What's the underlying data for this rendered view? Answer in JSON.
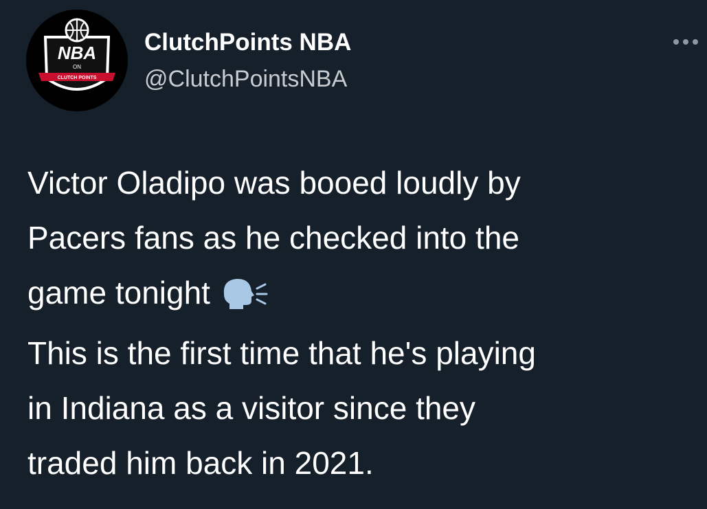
{
  "tweet": {
    "author": {
      "display_name": "ClutchPoints NBA",
      "handle": "@ClutchPointsNBA",
      "avatar": {
        "icon": "nba-on-clutchpoints-logo-icon",
        "logo_text_main": "NBA",
        "logo_text_small": "ON",
        "logo_banner_text": "CLUTCH POINTS"
      }
    },
    "more_icon": "more-options-icon",
    "paragraphs": [
      {
        "lines": [
          "Victor Oladipo was booed loudly by",
          "Pacers fans as he checked into the",
          "game tonight"
        ],
        "trailing_emoji": "speaking-head-icon"
      },
      {
        "lines": [
          "This is the first time that he's playing",
          "in Indiana as a visitor since they",
          "traded him back in 2021."
        ]
      }
    ],
    "colors": {
      "background": "#15202b",
      "text": "#ffffff",
      "handle": "#c8ccd0",
      "logo_red": "#c8102e",
      "emoji_blue": "#a9c8e6"
    }
  }
}
